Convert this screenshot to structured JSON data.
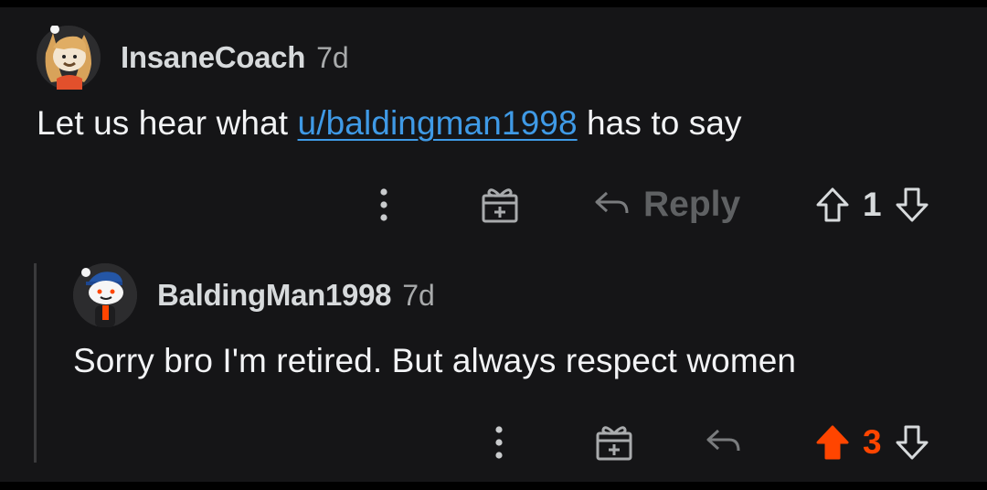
{
  "comments": [
    {
      "username": "InsaneCoach",
      "age": "7d",
      "body_prefix": "Let us hear what ",
      "body_link": "u/baldingman1998",
      "body_suffix": " has to say",
      "reply_label": "Reply",
      "score": "1",
      "upvoted": false
    },
    {
      "username": "BaldingMan1998",
      "age": "7d",
      "body": "Sorry bro I'm retired. But always respect women",
      "score": "3",
      "upvoted": true
    }
  ],
  "colors": {
    "background": "#151517",
    "link": "#3f9ae6",
    "upvote_active": "#ff4500",
    "username": "#d7dadc",
    "meta": "#a8aaab"
  },
  "icons": [
    "more-icon",
    "gift-icon",
    "reply-arrow-icon",
    "upvote-icon",
    "downvote-icon"
  ]
}
